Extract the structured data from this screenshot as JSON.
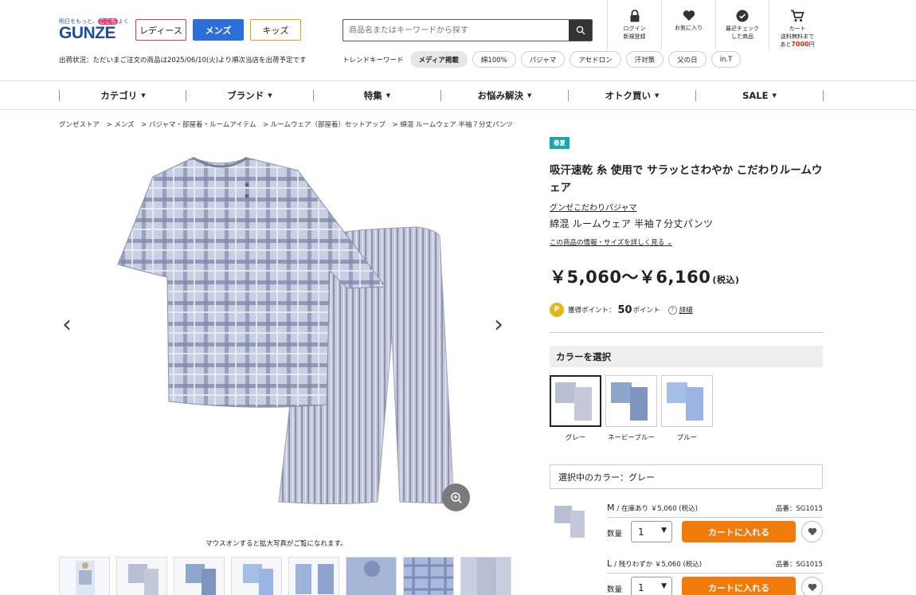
{
  "header": {
    "logo_tagline_pre": "明日をもっと、",
    "logo_tagline_mark": "ここち",
    "logo_tagline_post": "よく",
    "logo": "GUNZE",
    "gender_tabs": [
      "レディース",
      "メンズ",
      "キッズ"
    ],
    "shipping_status": "出荷状況：ただいまご注文の商品は2025/06/10(火)より順次当店を出荷予定です",
    "search": {
      "placeholder": "商品名またはキーワードから探す"
    },
    "trend_label": "トレンドキーワード",
    "trend_keywords": [
      "メディア掲載",
      "綿100%",
      "パジャマ",
      "アセドロン",
      "汗対策",
      "父の日",
      "in.T"
    ],
    "icons": [
      {
        "line1": "ログイン",
        "line2": "新規登録"
      },
      {
        "line1": "お気に入り",
        "line2": ""
      },
      {
        "line1": "最近チェック",
        "line2": "した商品"
      }
    ],
    "cart": {
      "label": "カート",
      "free_line1": "送料無料まで",
      "free_pre": "あと",
      "free_amount": "7000",
      "free_unit": "円"
    }
  },
  "nav": [
    "カテゴリ",
    "ブランド",
    "特集",
    "お悩み解決",
    "オトク買い",
    "SALE"
  ],
  "breadcrumb": "グンゼストア　> メンズ　> パジャマ・部屋着・ルームアイテム　> ルームウェア（部屋着）セットアップ　> 綿混 ルームウェア 半袖７分丈パンツ",
  "gallery": {
    "mouseover_text": "マウスオンすると拡大写真がご覧になれます。"
  },
  "product": {
    "badge": "春夏",
    "title": "吸汗速乾 糸 使用で サラッとさわやか こだわりルームウェア",
    "series": "グンゼこだわりパジャマ",
    "name": "綿混 ルームウェア 半袖７分丈パンツ",
    "detail_link": "この商品の情報・サイズを詳しく見る",
    "price": "￥5,060～￥6,160",
    "price_tax": "(税込)",
    "points_label": "獲得ポイント：",
    "points_value": "50",
    "points_unit": "ポイント",
    "points_help": "詳細",
    "color_heading": "カラーを選択",
    "colors": [
      "グレー",
      "ネービーブルー",
      "ブルー"
    ],
    "selected_color": "選択中のカラー：グレー",
    "variants": [
      {
        "size": "M",
        "stock": "/ 在庫あり ￥5,060 (税込)",
        "sku": "品番：SG1015",
        "qty_label": "数量",
        "qty": "1",
        "cart_label": "カートに入れる"
      },
      {
        "size": "L",
        "stock": "/ 残りわずか ￥5,060 (税込)",
        "sku": "品番：SG1015",
        "qty_label": "数量",
        "qty": "1",
        "cart_label": "カートに入れる"
      }
    ]
  },
  "colors": {
    "brand_blue": "#1b4ea0",
    "mens_blue": "#2d6ed8",
    "cart_orange": "#f07a0a",
    "badge_teal": "#17a6ac",
    "points_gold": "#e4b61a"
  }
}
